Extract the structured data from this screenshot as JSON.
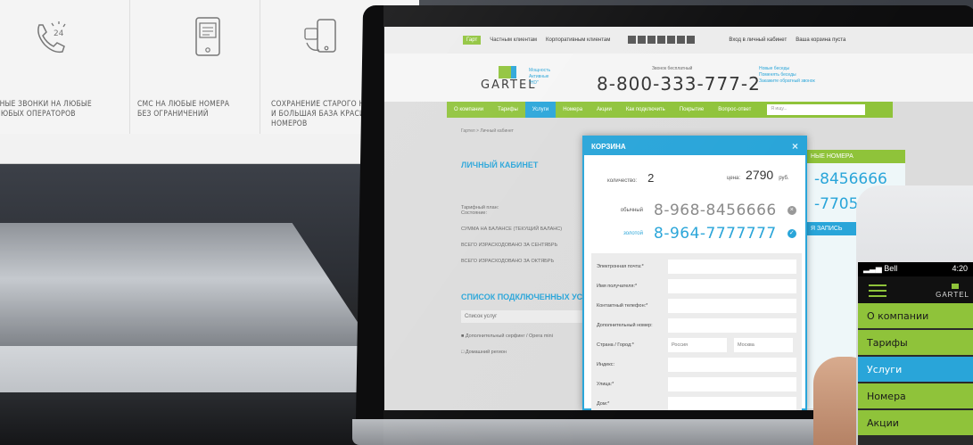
{
  "monitor": {
    "features": [
      {
        "icon": "phone-24h-icon",
        "text": "МИТНЫЕ ЗВОНКИ НА ЛЮБЫЕ\nРА ЛЮБЫХ ОПЕРАТОРОВ"
      },
      {
        "icon": "sms-phone-icon",
        "text": "СМС НА ЛЮБЫЕ НОМЕРА\nБЕЗ ОГРАНИЧЕНИЙ"
      },
      {
        "icon": "number-transfer-icon",
        "text": "СОХРАНЕНИЕ СТАРОГО НО\nИ БОЛЬШАЯ БАЗА КРАСИ\nНОМЕРОВ"
      }
    ]
  },
  "site": {
    "topbar": {
      "badge": "Гарт",
      "items": [
        "Частным клиентам",
        "Корпоративным клиентам"
      ],
      "login": "Вход в личный кабинет",
      "cart": "Ваша корзина пуста"
    },
    "logo": "GARTEL",
    "hint": "Мощность\nАктивные\n\"HD\"",
    "free_call": "Звонок бесплатный",
    "phone": "8-800-333-777-2",
    "side_links": "Новые беседы\nПоменять беседы\nЗакажите обратный звонок",
    "nav": [
      "О компании",
      "Тарифы",
      "Услуги",
      "Номера",
      "Акции",
      "Как подключить",
      "Покрытие",
      "Вопрос-ответ"
    ],
    "nav_active_index": 2,
    "search_placeholder": "Я ищу...",
    "breadcrumbs": "Гартел  >  Личный кабинет",
    "cabinet": {
      "title": "ЛИЧНЫЙ КАБИНЕТ",
      "rows": [
        "Тарифный план:\nСостояние:",
        "СУММА НА БАЛАНСЕ (текущий баланс)",
        "ВСЕГО ИЗРАСХОДОВАНО ЗА СЕНТЯБРЬ",
        "ВСЕГО ИЗРАСХОДОВАНО ЗА ОКТЯБРЬ"
      ],
      "services_title": "СПИСОК ПОДКЛЮЧЕННЫХ УС",
      "services_header": "Список услуг",
      "services": [
        "Дополнительный серфинг / Opera mini",
        "Домашний регион"
      ]
    },
    "right_panel": {
      "green_title": "НЫЕ НОМЕРА",
      "numbers": [
        "-8456666",
        "-7705"
      ],
      "blue_title": "Я ЗАПИСЬ"
    }
  },
  "cart_modal": {
    "title": "КОРЗИНА",
    "close": "×",
    "quantity_label": "количество:",
    "quantity": "2",
    "price_label": "цена:",
    "price": "2790",
    "currency": "руб.",
    "items": [
      {
        "type": "обычный",
        "number": "8-968-8456666",
        "action": "×"
      },
      {
        "type": "золотой",
        "number": "8-964-7777777",
        "action": "✓"
      }
    ],
    "form": {
      "fields": [
        "Электронная почта:*",
        "Имя получателя:*",
        "Контактный телефон:*",
        "Дополнительный номер:",
        "Страна / Город:*",
        "Индекс:",
        "Улица:*",
        "Дом:*"
      ],
      "country_value": "Россия",
      "city_value": "Москва"
    }
  },
  "phone": {
    "carrier": "Bell",
    "time": "4:20",
    "logo": "GARTEL",
    "menu": [
      "О компании",
      "Тарифы",
      "Услуги",
      "Номера",
      "Акции"
    ],
    "active_index": 2
  }
}
